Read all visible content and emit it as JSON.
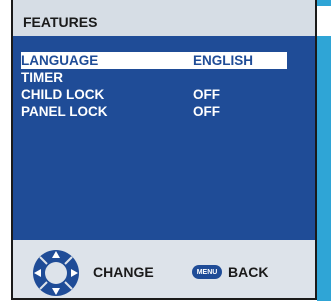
{
  "header": {
    "title": "FEATURES"
  },
  "menu": {
    "items": [
      {
        "label": "LANGUAGE",
        "value": "ENGLISH",
        "selected": true
      },
      {
        "label": "TIMER",
        "value": ""
      },
      {
        "label": "CHILD LOCK",
        "value": "OFF"
      },
      {
        "label": "PANEL LOCK",
        "value": "OFF"
      }
    ]
  },
  "footer": {
    "change_label": "CHANGE",
    "menu_button_label": "MENU",
    "back_label": "BACK"
  },
  "colors": {
    "panel_blue": "#1f4c97",
    "accent_teal": "#2fa5d6",
    "frame_gray": "#dde3ea"
  }
}
